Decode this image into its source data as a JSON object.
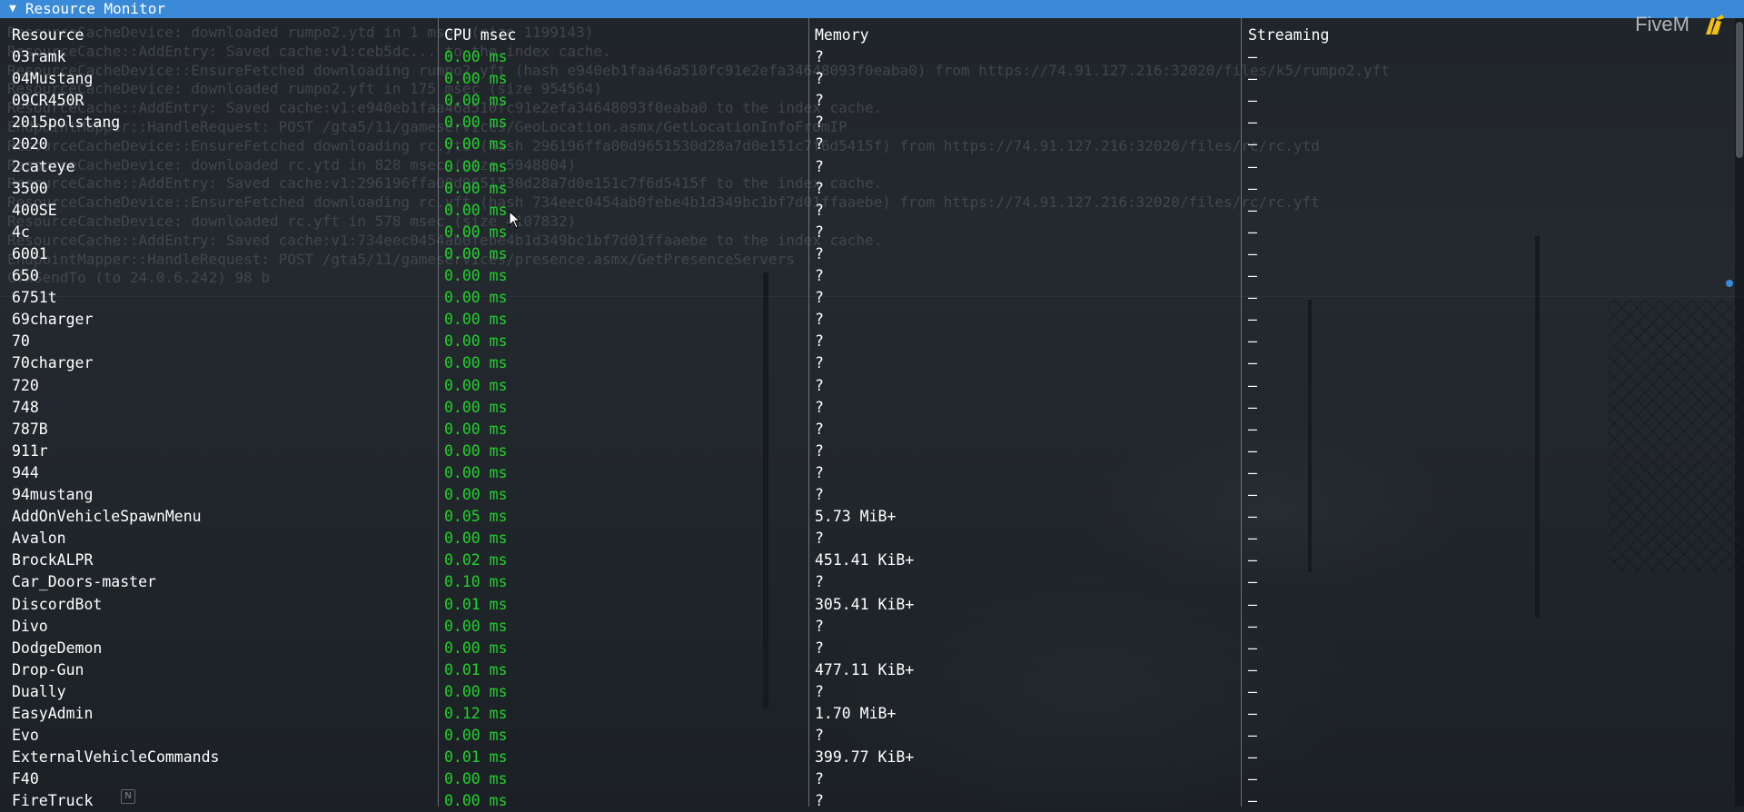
{
  "window": {
    "title": "Resource Monitor",
    "collapse_icon": "triangle-down-icon"
  },
  "brand": {
    "label": "FiveM",
    "icon": "fivem-logo-icon",
    "accent": "#f2c10f"
  },
  "colors": {
    "titlebar": "#3a8ad8",
    "cpu": "#20d22a",
    "log": "#747a80"
  },
  "columns": {
    "resource": "Resource",
    "cpu": "CPU msec",
    "memory": "Memory",
    "streaming": "Streaming"
  },
  "console_log": [
    "ResourceCacheDevice: downloaded rumpo2.ytd in 1 msec (size 1199143)",
    "ResourceCache::AddEntry: Saved cache:v1:ceb5dc... to the index cache.",
    "ResourceCacheDevice::EnsureFetched downloading rumpo2.yft (hash e940eb1faa46a510fc91e2efa34648093f0eaba0) from https://74.91.127.216:32020/files/k5/rumpo2.yft",
    "ResourceCacheDevice: downloaded rumpo2.yft in 175 msec (size 954564)",
    "ResourceCache::AddEntry: Saved cache:v1:e940eb1faa46a510fc91e2efa34648093f0eaba0 to the index cache.",
    "EndpointMapper::HandleRequest: POST /gta5/11/gameservices/GeoLocation.asmx/GetLocationInfoFromIP",
    "ResourceCacheDevice::EnsureFetched downloading rc.ytd (hash 296196ffa00d9651530d28a7d0e151c7f6d5415f) from https://74.91.127.216:32020/files/rc/rc.ytd",
    "ResourceCacheDevice: downloaded rc.ytd in 828 msec (size 5948804)",
    "ResourceCache::AddEntry: Saved cache:v1:296196ffa00d9651530d28a7d0e151c7f6d5415f to the index cache.",
    "ResourceCacheDevice::EnsureFetched downloading rc.yft (hash 734eec0454ab0febe4b1d349bc1bf7d01ffaaebe) from https://74.91.127.216:32020/files/rc/rc.yft",
    "ResourceCacheDevice: downloaded rc.yft in 578 msec (size 4107832)",
    "ResourceCache::AddEntry: Saved cache:v1:734eec0454ab0febe4b1d349bc1bf7d01ffaaebe to the index cache.",
    "EndpointMapper::HandleRequest: POST /gta5/11/gameservices/presence.asmx/GetPresenceServers",
    "CfxSendTo (to 24.0.6.242) 98 b"
  ],
  "rows": [
    {
      "resource": "03ramk",
      "cpu": "0.00 ms",
      "memory": "?",
      "streaming": "–"
    },
    {
      "resource": "04Mustang",
      "cpu": "0.00 ms",
      "memory": "?",
      "streaming": "–"
    },
    {
      "resource": "09CR450R",
      "cpu": "0.00 ms",
      "memory": "?",
      "streaming": "–"
    },
    {
      "resource": "2015polstang",
      "cpu": "0.00 ms",
      "memory": "?",
      "streaming": "–"
    },
    {
      "resource": "2020",
      "cpu": "0.00 ms",
      "memory": "?",
      "streaming": "–"
    },
    {
      "resource": "2cateye",
      "cpu": "0.00 ms",
      "memory": "?",
      "streaming": "–"
    },
    {
      "resource": "3500",
      "cpu": "0.00 ms",
      "memory": "?",
      "streaming": "–"
    },
    {
      "resource": "400SE",
      "cpu": "0.00 ms",
      "memory": "?",
      "streaming": "–"
    },
    {
      "resource": "4c",
      "cpu": "0.00 ms",
      "memory": "?",
      "streaming": "–"
    },
    {
      "resource": "6001",
      "cpu": "0.00 ms",
      "memory": "?",
      "streaming": "–"
    },
    {
      "resource": "650",
      "cpu": "0.00 ms",
      "memory": "?",
      "streaming": "–"
    },
    {
      "resource": "6751t",
      "cpu": "0.00 ms",
      "memory": "?",
      "streaming": "–"
    },
    {
      "resource": "69charger",
      "cpu": "0.00 ms",
      "memory": "?",
      "streaming": "–"
    },
    {
      "resource": "70",
      "cpu": "0.00 ms",
      "memory": "?",
      "streaming": "–"
    },
    {
      "resource": "70charger",
      "cpu": "0.00 ms",
      "memory": "?",
      "streaming": "–"
    },
    {
      "resource": "720",
      "cpu": "0.00 ms",
      "memory": "?",
      "streaming": "–"
    },
    {
      "resource": "748",
      "cpu": "0.00 ms",
      "memory": "?",
      "streaming": "–"
    },
    {
      "resource": "787B",
      "cpu": "0.00 ms",
      "memory": "?",
      "streaming": "–"
    },
    {
      "resource": "911r",
      "cpu": "0.00 ms",
      "memory": "?",
      "streaming": "–"
    },
    {
      "resource": "944",
      "cpu": "0.00 ms",
      "memory": "?",
      "streaming": "–"
    },
    {
      "resource": "94mustang",
      "cpu": "0.00 ms",
      "memory": "?",
      "streaming": "–"
    },
    {
      "resource": "AddOnVehicleSpawnMenu",
      "cpu": "0.05 ms",
      "memory": "5.73 MiB+",
      "streaming": "–"
    },
    {
      "resource": "Avalon",
      "cpu": "0.00 ms",
      "memory": "?",
      "streaming": "–"
    },
    {
      "resource": "BrockALPR",
      "cpu": "0.02 ms",
      "memory": "451.41 KiB+",
      "streaming": "–"
    },
    {
      "resource": "Car_Doors-master",
      "cpu": "0.10 ms",
      "memory": "?",
      "streaming": "–"
    },
    {
      "resource": "DiscordBot",
      "cpu": "0.01 ms",
      "memory": "305.41 KiB+",
      "streaming": "–"
    },
    {
      "resource": "Divo",
      "cpu": "0.00 ms",
      "memory": "?",
      "streaming": "–"
    },
    {
      "resource": "DodgeDemon",
      "cpu": "0.00 ms",
      "memory": "?",
      "streaming": "–"
    },
    {
      "resource": "Drop-Gun",
      "cpu": "0.01 ms",
      "memory": "477.11 KiB+",
      "streaming": "–"
    },
    {
      "resource": "Dually",
      "cpu": "0.00 ms",
      "memory": "?",
      "streaming": "–"
    },
    {
      "resource": "EasyAdmin",
      "cpu": "0.12 ms",
      "memory": "1.70 MiB+",
      "streaming": "–"
    },
    {
      "resource": "Evo",
      "cpu": "0.00 ms",
      "memory": "?",
      "streaming": "–"
    },
    {
      "resource": "ExternalVehicleCommands",
      "cpu": "0.01 ms",
      "memory": "399.77 KiB+",
      "streaming": "–"
    },
    {
      "resource": "F40",
      "cpu": "0.00 ms",
      "memory": "?",
      "streaming": "–"
    },
    {
      "resource": "FireTruck",
      "cpu": "0.00 ms",
      "memory": "?",
      "streaming": "–"
    }
  ],
  "key_hint": "N"
}
